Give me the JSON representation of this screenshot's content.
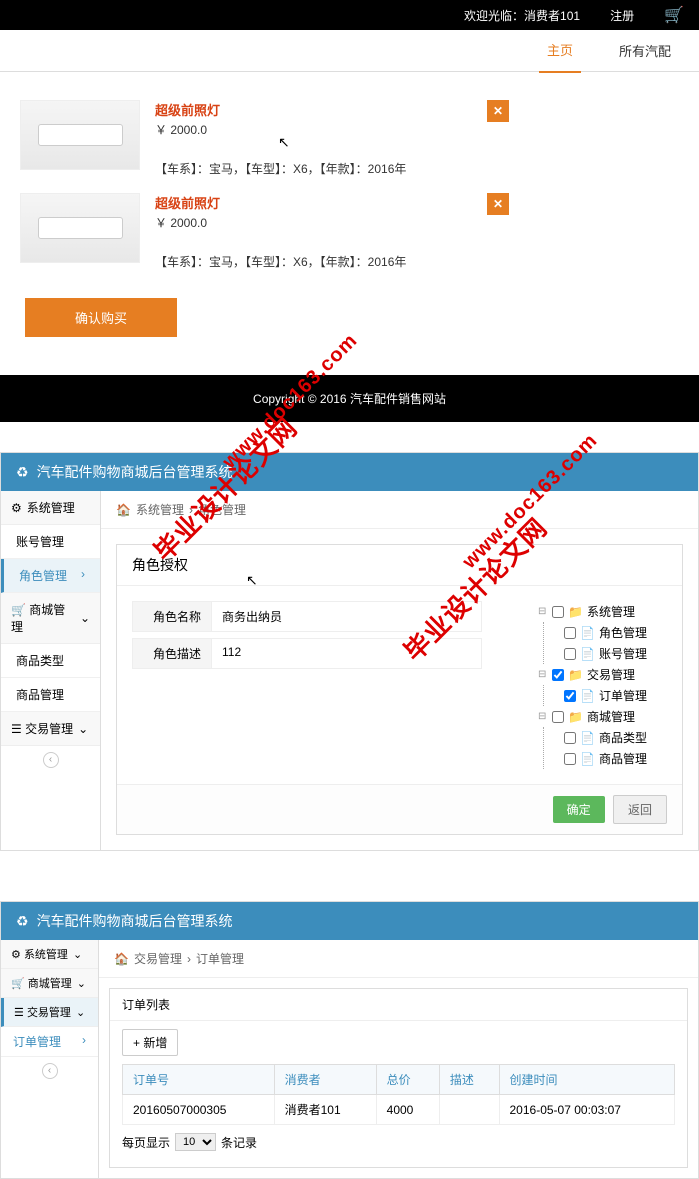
{
  "topbar": {
    "welcome": "欢迎光临：消费者101",
    "register": "注册"
  },
  "nav": {
    "home": "主页",
    "allparts": "所有汽配"
  },
  "cart": {
    "items": [
      {
        "title": "超级前照灯",
        "price": "￥ 2000.0",
        "desc": "【车系】：宝马，【车型】：X6，【年款】：2016年"
      },
      {
        "title": "超级前照灯",
        "price": "￥ 2000.0",
        "desc": "【车系】：宝马，【车型】：X6，【年款】：2016年"
      }
    ],
    "confirm": "确认购买"
  },
  "footer": {
    "copyright": "Copyright © 2016 汽车配件销售网站"
  },
  "admin1": {
    "system_title": "汽车配件购物商城后台管理系统",
    "sidebar": {
      "sys_mgmt": "系统管理",
      "account_mgmt": "账号管理",
      "role_mgmt": "角色管理",
      "mall_mgmt": "商城管理",
      "product_type": "商品类型",
      "product_mgmt": "商品管理",
      "trade_mgmt": "交易管理"
    },
    "breadcrumb": {
      "l1": "系统管理",
      "l2": "角色管理"
    },
    "panel_title": "角色授权",
    "form": {
      "name_label": "角色名称",
      "name_value": "商务出纳员",
      "desc_label": "角色描述",
      "desc_value": "112"
    },
    "tree": {
      "sys_mgmt": "系统管理",
      "role_mgmt": "角色管理",
      "account_mgmt": "账号管理",
      "trade_mgmt": "交易管理",
      "order_mgmt": "订单管理",
      "mall_mgmt": "商城管理",
      "product_type": "商品类型",
      "product_mgmt": "商品管理"
    },
    "buttons": {
      "confirm": "确定",
      "back": "返回"
    }
  },
  "admin2": {
    "system_title": "汽车配件购物商城后台管理系统",
    "sidebar": {
      "sys_mgmt": "系统管理",
      "mall_mgmt": "商城管理",
      "trade_mgmt": "交易管理",
      "order_mgmt": "订单管理"
    },
    "breadcrumb": {
      "l1": "交易管理",
      "l2": "订单管理"
    },
    "panel_title": "订单列表",
    "new_btn": "+ 新增",
    "table": {
      "headers": {
        "order_no": "订单号",
        "consumer": "消费者",
        "total": "总价",
        "desc": "描述",
        "created": "创建时间"
      },
      "row": {
        "order_no": "20160507000305",
        "consumer": "消费者101",
        "total": "4000",
        "desc": "",
        "created": "2016-05-07 00:03:07"
      }
    },
    "pagination": {
      "label": "每页显示",
      "value": "10",
      "records": "条记录"
    }
  },
  "watermark": {
    "cn": "毕业设计论文网",
    "url": "www.doc163.com"
  }
}
